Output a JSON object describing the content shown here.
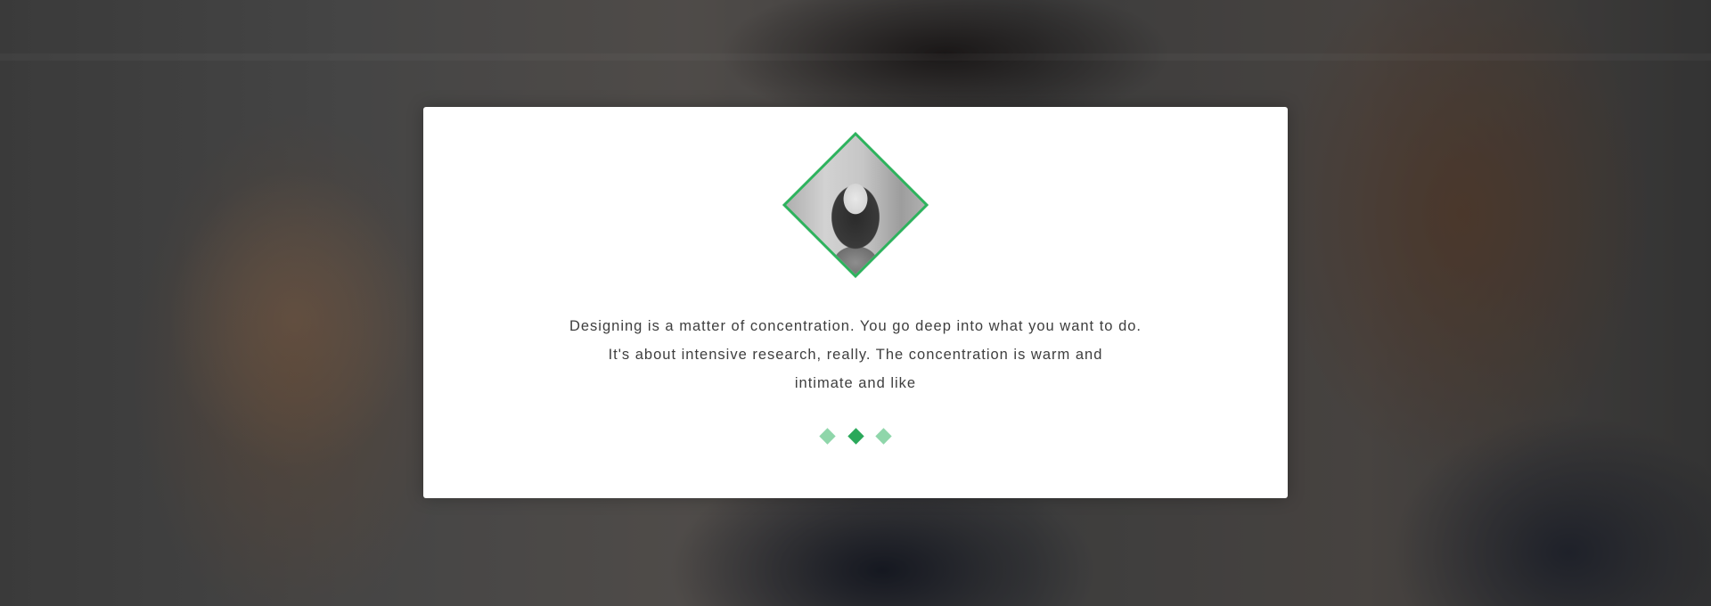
{
  "testimonial": {
    "avatar_icon": "portrait-avatar",
    "quote_lines": [
      "Designing is a matter of concentration. You go deep into what you want to do.",
      "It's about intensive research, really. The concentration is warm and",
      "intimate and like"
    ],
    "pagination": {
      "count": 3,
      "active_index": 1
    }
  },
  "colors": {
    "accent": "#2db35d",
    "dot_inactive": "#8fd6aa",
    "dot_active": "#2aa85a",
    "card_bg": "#ffffff",
    "text": "#3e3e3e"
  }
}
